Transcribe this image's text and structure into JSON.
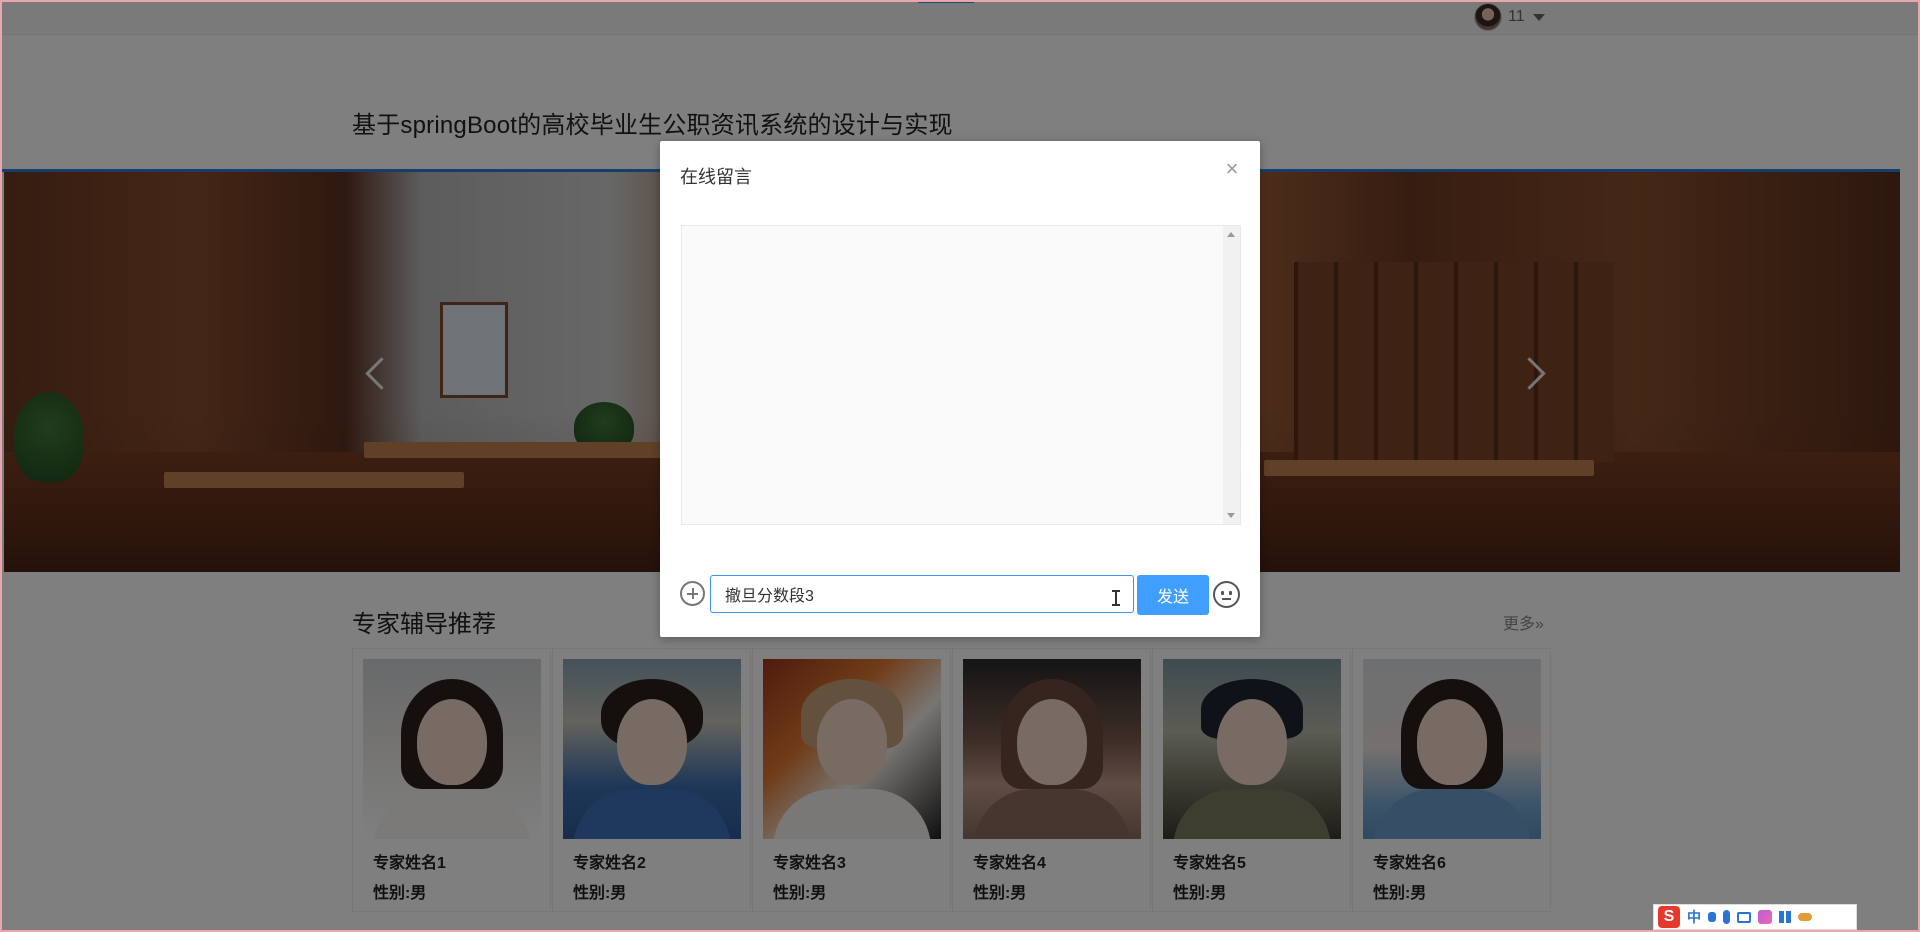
{
  "topbar": {
    "username": "11"
  },
  "header": {
    "site_title": "基于springBoot的高校毕业生公职资讯系统的设计与实现"
  },
  "experts": {
    "section_title": "专家辅导推荐",
    "more_label": "更多»",
    "cards": [
      {
        "name": "专家姓名1",
        "gender": "性别:男"
      },
      {
        "name": "专家姓名2",
        "gender": "性别:男"
      },
      {
        "name": "专家姓名3",
        "gender": "性别:男"
      },
      {
        "name": "专家姓名4",
        "gender": "性别:男"
      },
      {
        "name": "专家姓名5",
        "gender": "性别:男"
      },
      {
        "name": "专家姓名6",
        "gender": "性别:男"
      }
    ]
  },
  "dialog": {
    "title": "在线留言",
    "close_glyph": "×",
    "input_value": "撤旦分数段3",
    "send_label": "发送"
  },
  "ime": {
    "logo": "S",
    "lang": "中"
  },
  "icons": {
    "avatar": "user-avatar",
    "caret": "chevron-down-icon",
    "prev": "chevron-left-icon",
    "next": "chevron-right-icon",
    "add": "plus-circle-icon",
    "emoji": "emoji-icon",
    "close": "close-icon"
  },
  "colors": {
    "accent": "#409eff",
    "header_line": "#2a7fd4"
  }
}
